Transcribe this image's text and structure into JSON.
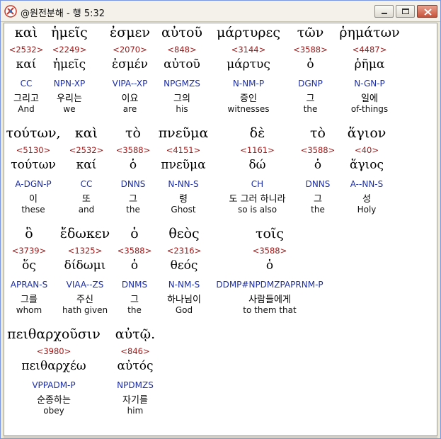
{
  "window": {
    "title": "@원전분해 - 행 5:32"
  },
  "words": [
    {
      "greek": "καὶ",
      "strong": "<2532>",
      "lemma": "καί",
      "morph": "CC",
      "korean": "그리고",
      "english": "And",
      "selected": true
    },
    {
      "greek": "ἡμεῖς",
      "strong": "<2249>",
      "lemma": "ἡμεῖς",
      "morph": "NPN-XP",
      "korean": "우리는",
      "english": "we"
    },
    {
      "greek": "ἐσμεν",
      "strong": "<2070>",
      "lemma": "ἐσμέν",
      "morph": "VIPA--XP",
      "korean": "이요",
      "english": "are"
    },
    {
      "greek": "αὐτοῦ",
      "strong": "<848>",
      "lemma": "αὐτοῦ",
      "morph": "NPGMZS",
      "korean": "그의",
      "english": "his"
    },
    {
      "greek": "μάρτυρες",
      "strong": "<3144>",
      "lemma": "μάρτυς",
      "morph": "N-NM-P",
      "korean": "증인",
      "english": "witnesses"
    },
    {
      "greek": "τῶν",
      "strong": "<3588>",
      "lemma": "ὁ",
      "morph": "DGNP",
      "korean": "그",
      "english": "the"
    },
    {
      "greek": "ῥημάτων",
      "strong": "<4487>",
      "lemma": "ῥῆμα",
      "morph": "N-GN-P",
      "korean": "일에",
      "english": "of-things"
    },
    {
      "greek": "τούτων,",
      "strong": "<5130>",
      "lemma": "τούτων",
      "morph": "A-DGN-P",
      "korean": "이",
      "english": "these"
    },
    {
      "greek": "καὶ",
      "strong": "<2532>",
      "lemma": "καί",
      "morph": "CC",
      "korean": "또",
      "english": "and"
    },
    {
      "greek": "τὸ",
      "strong": "<3588>",
      "lemma": "ὁ",
      "morph": "DNNS",
      "korean": "그",
      "english": "the"
    },
    {
      "greek": "πνεῦμα",
      "strong": "<4151>",
      "lemma": "πνεῦμα",
      "morph": "N-NN-S",
      "korean": "령",
      "english": "Ghost"
    },
    {
      "greek": "δὲ",
      "strong": "<1161>",
      "lemma": "δώ",
      "morph": "CH",
      "korean": "도 그러 하니라",
      "english": "so is also"
    },
    {
      "greek": "τὸ",
      "strong": "<3588>",
      "lemma": "ὁ",
      "morph": "DNNS",
      "korean": "그",
      "english": "the"
    },
    {
      "greek": "ἅγιον",
      "strong": "<40>",
      "lemma": "ἅγιος",
      "morph": "A--NN-S",
      "korean": "성",
      "english": "Holy"
    },
    {
      "greek": "ὃ",
      "strong": "<3739>",
      "lemma": "ὅς",
      "morph": "APRAN-S",
      "korean": "그를",
      "english": "whom"
    },
    {
      "greek": "ἔδωκεν",
      "strong": "<1325>",
      "lemma": "δίδωμι",
      "morph": "VIAA--ZS",
      "korean": "주신",
      "english": "hath given"
    },
    {
      "greek": "ὁ",
      "strong": "<3588>",
      "lemma": "ὁ",
      "morph": "DNMS",
      "korean": "그",
      "english": "the"
    },
    {
      "greek": "θεὸς",
      "strong": "<2316>",
      "lemma": "θεός",
      "morph": "N-NM-S",
      "korean": "하나님이",
      "english": "God"
    },
    {
      "greek": "τοῖς",
      "strong": "<3588>",
      "lemma": "ὁ",
      "morph": "DDMP#NPDMZPAPRNM-P",
      "korean": "사람들에게",
      "english": "to them that"
    },
    {
      "greek": "πειθαρχοῦσιν",
      "strong": "<3980>",
      "lemma": "πειθαρχέω",
      "morph": "VPPADM-P",
      "korean": "순종하는",
      "english": "obey"
    },
    {
      "greek": "αὐτῷ.",
      "strong": "<846>",
      "lemma": "αὐτός",
      "morph": "NPDMZS",
      "korean": "자기를",
      "english": "him"
    }
  ]
}
